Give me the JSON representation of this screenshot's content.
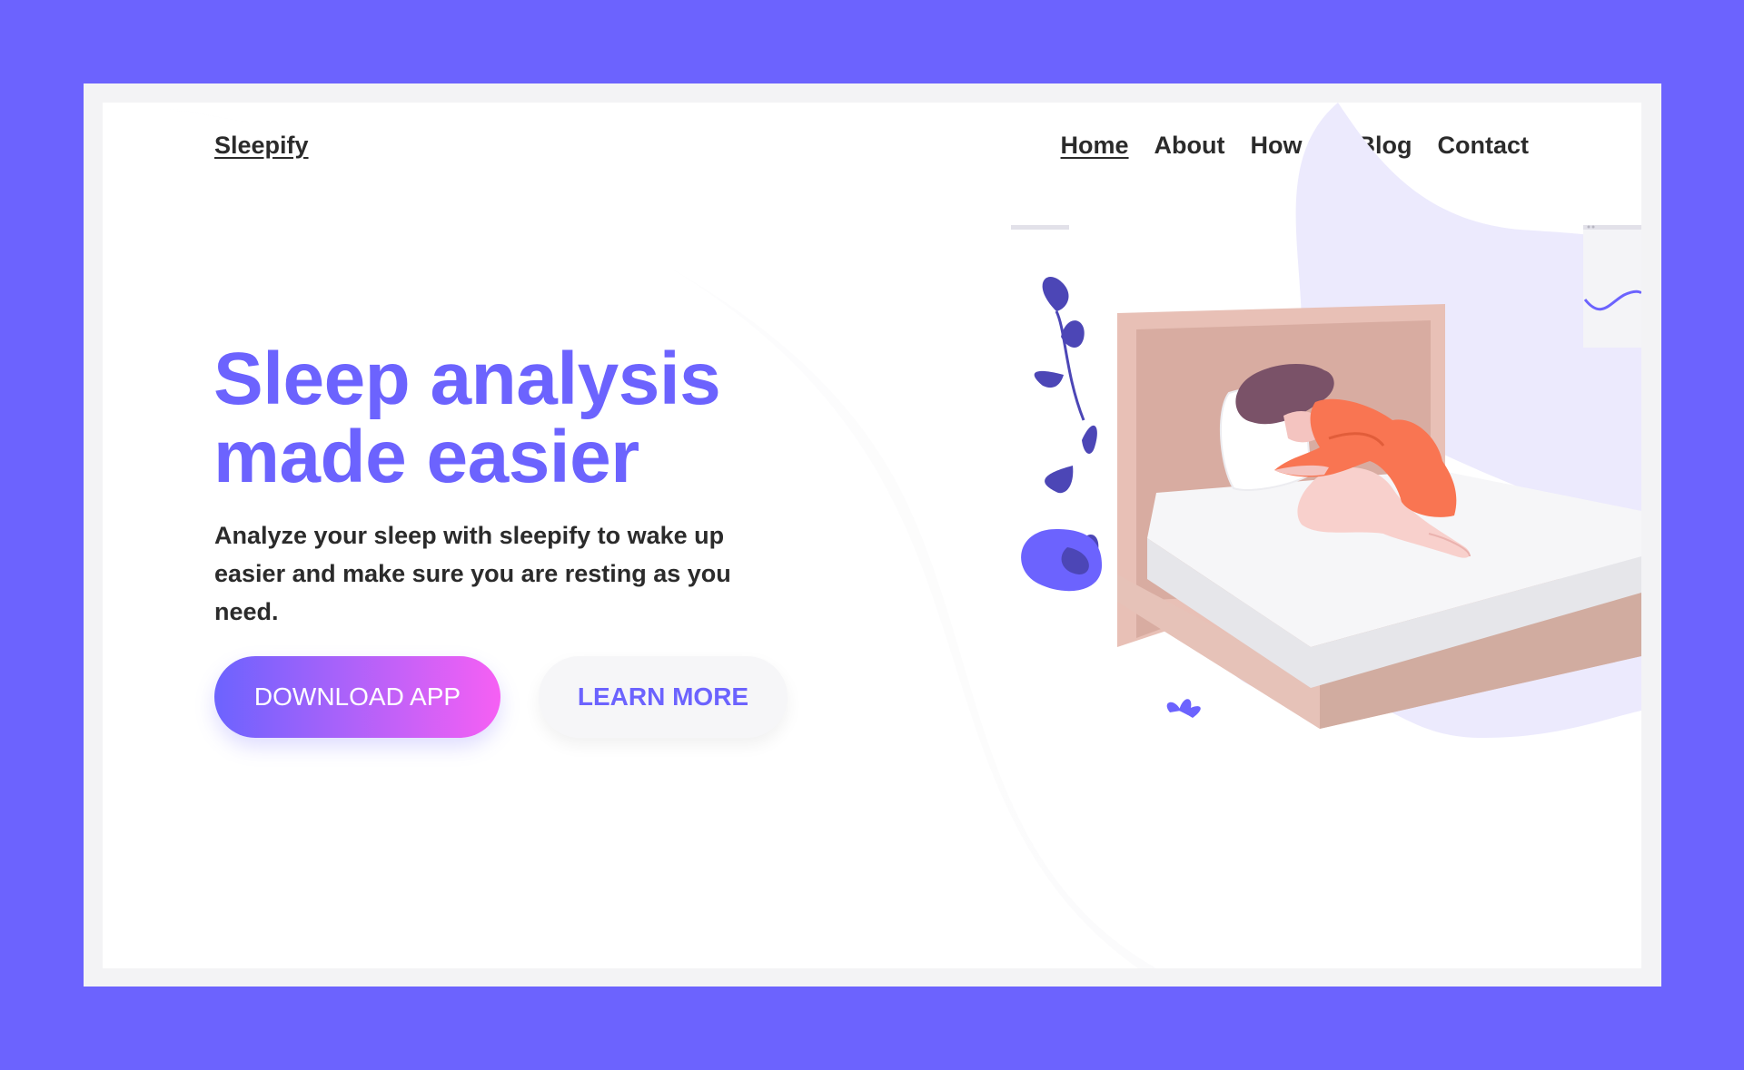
{
  "brand": {
    "name": "Sleepify"
  },
  "nav": {
    "items": [
      {
        "label": "Home",
        "active": true
      },
      {
        "label": "About",
        "active": false
      },
      {
        "label": "How to",
        "active": false
      },
      {
        "label": "Blog",
        "active": false
      },
      {
        "label": "Contact",
        "active": false
      }
    ]
  },
  "hero": {
    "title_line1": "Sleep analysis",
    "title_line2": "made easier",
    "subtitle": "Analyze your sleep with sleepify to wake up easier and make sure you are resting as you need.",
    "primary_button": "DOWNLOAD APP",
    "secondary_button": "LEARN MORE"
  },
  "colors": {
    "background": "#6c63fe",
    "accent": "#6c63fe",
    "gradient_end": "#f660f4",
    "text": "#2b2b2b"
  },
  "icons": {
    "illustration": "woman-sleeping-in-bed-illustration"
  }
}
